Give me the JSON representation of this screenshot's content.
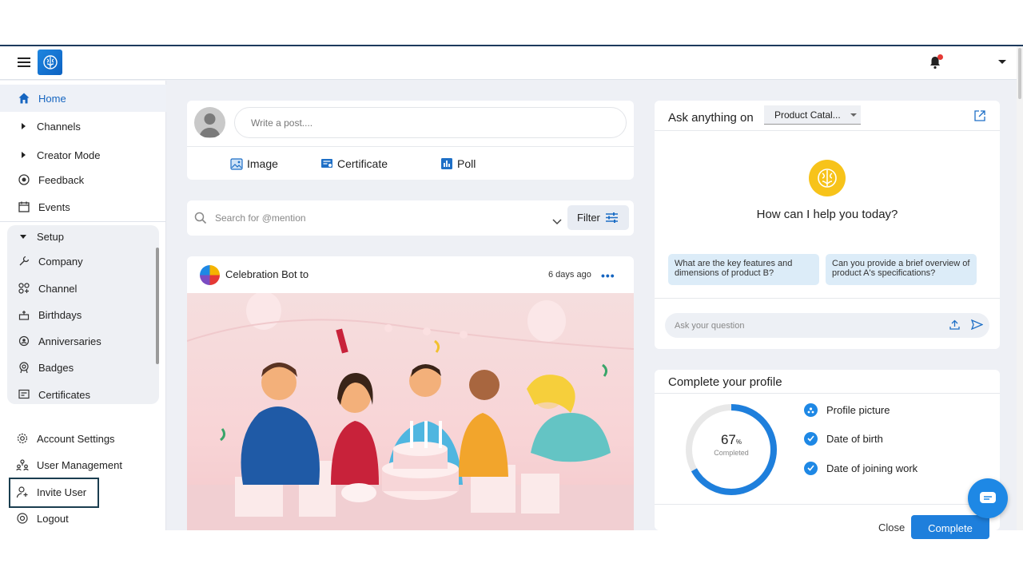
{
  "header": {
    "menu_icon": "hamburger-icon",
    "logo_icon": "brain-icon",
    "notification_icon": "bell-icon",
    "profile_icon": "caret-down-icon"
  },
  "sidebar": {
    "items": [
      {
        "label": "Home",
        "icon": "home-icon"
      },
      {
        "label": "Channels",
        "icon": "caret-right-icon"
      },
      {
        "label": "Creator Mode",
        "icon": "caret-right-icon"
      },
      {
        "label": "Feedback",
        "icon": "feedback-icon"
      },
      {
        "label": "Events",
        "icon": "calendar-icon"
      }
    ],
    "setup": {
      "label": "Setup",
      "items": [
        {
          "label": "Company",
          "icon": "wrench-icon"
        },
        {
          "label": "Channel",
          "icon": "channel-icon"
        },
        {
          "label": "Birthdays",
          "icon": "cake-icon"
        },
        {
          "label": "Anniversaries",
          "icon": "anniversary-icon"
        },
        {
          "label": "Badges",
          "icon": "badge-icon"
        },
        {
          "label": "Certificates",
          "icon": "certificate-icon"
        }
      ]
    },
    "bottom": [
      {
        "label": "Account Settings",
        "icon": "gear-icon"
      },
      {
        "label": "User Management",
        "icon": "users-icon"
      },
      {
        "label": "Invite User",
        "icon": "add-user-icon"
      },
      {
        "label": "Logout",
        "icon": "logout-icon"
      }
    ]
  },
  "composer": {
    "placeholder": "Write a post....",
    "actions": [
      {
        "label": "Image",
        "icon": "image-icon"
      },
      {
        "label": "Certificate",
        "icon": "certificate-icon"
      },
      {
        "label": "Poll",
        "icon": "poll-icon"
      }
    ]
  },
  "search": {
    "placeholder": "Search for @mention",
    "filter_label": "Filter"
  },
  "post": {
    "author": "Celebration Bot to",
    "time": "6 days ago",
    "more": "•••"
  },
  "ai": {
    "title": "Ask anything on",
    "selected": "Product Catal...",
    "help": "How can I help you today?",
    "suggestions": [
      "What are the key features and dimensions of product B?",
      "Can you provide a brief overview of product A's specifications?"
    ],
    "ask_placeholder": "Ask your question"
  },
  "profile": {
    "title": "Complete your profile",
    "percent": 67,
    "percent_label": "67",
    "percent_sign": "%",
    "completed_label": "Completed",
    "tasks": [
      "Profile picture",
      "Date of birth",
      "Date of joining work"
    ],
    "close_label": "Close",
    "complete_label": "Complete"
  },
  "colors": {
    "accent": "#1e88e5",
    "home_active": "#1565c0",
    "ai_logo": "#f7c31a"
  }
}
